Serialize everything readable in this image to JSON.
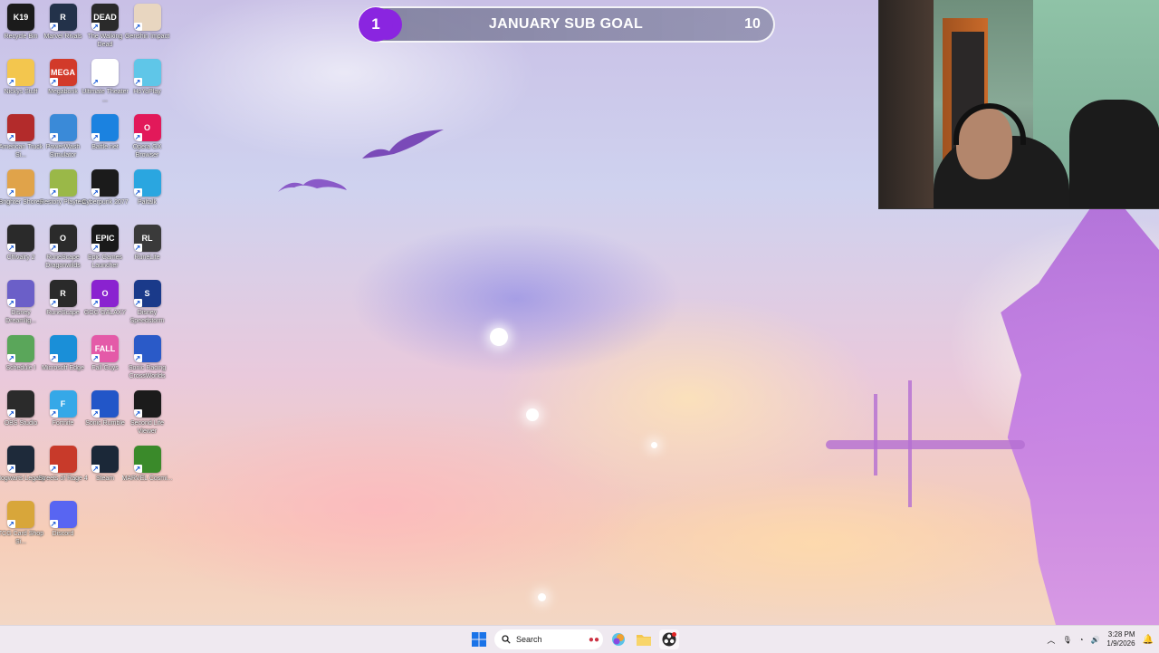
{
  "subgoal": {
    "current": "1",
    "title": "JANUARY SUB GOAL",
    "target": "10"
  },
  "desktop_icons": [
    {
      "label": "Recycle Bin",
      "icon": "recycle-bin-icon",
      "color": "#1b1b1b",
      "badge": "K19"
    },
    {
      "label": "Marvel Rivals",
      "icon": "marvel-rivals-icon",
      "color": "#23324a",
      "badge": "R"
    },
    {
      "label": "The Walking Dead",
      "icon": "walking-dead-icon",
      "color": "#2a2a2a",
      "badge": "DEAD"
    },
    {
      "label": "Genshin Impact",
      "icon": "genshin-icon",
      "color": "#e8d6c0",
      "badge": ""
    },
    {
      "label": "Nickys Stuff",
      "icon": "folder-icon",
      "color": "#f3c64e",
      "badge": ""
    },
    {
      "label": "Megabonk",
      "icon": "megabonk-icon",
      "color": "#d23a2a",
      "badge": "MEGA"
    },
    {
      "label": "Ultimate Theater ...",
      "icon": "popcorn-icon",
      "color": "#ffffff",
      "badge": ""
    },
    {
      "label": "HoYoPlay",
      "icon": "hoyoplay-icon",
      "color": "#5fc6e8",
      "badge": ""
    },
    {
      "label": "American Truck Si...",
      "icon": "truck-icon",
      "color": "#b32b2b",
      "badge": ""
    },
    {
      "label": "PowerWash Simulator",
      "icon": "powerwash-icon",
      "color": "#3a8ad8",
      "badge": ""
    },
    {
      "label": "Battle.net",
      "icon": "battlenet-icon",
      "color": "#1b82e0",
      "badge": ""
    },
    {
      "label": "Opera GX Browser",
      "icon": "opera-gx-icon",
      "color": "#e2195a",
      "badge": "O"
    },
    {
      "label": "Brighter Shores",
      "icon": "brighter-shores-icon",
      "color": "#e0a34a",
      "badge": ""
    },
    {
      "label": "Restory Playtest",
      "icon": "restory-icon",
      "color": "#9ab848",
      "badge": ""
    },
    {
      "label": "Cyberpunk 2077",
      "icon": "cyberpunk-icon",
      "color": "#1b1b1b",
      "badge": ""
    },
    {
      "label": "Paltalk",
      "icon": "paltalk-icon",
      "color": "#2aa6e0",
      "badge": ""
    },
    {
      "label": "Chivalry 2",
      "icon": "chivalry-icon",
      "color": "#2a2a2a",
      "badge": ""
    },
    {
      "label": "RuneScape Dragonwilds",
      "icon": "dragonwilds-icon",
      "color": "#2b2b2b",
      "badge": "O"
    },
    {
      "label": "Epic Games Launcher",
      "icon": "epic-games-icon",
      "color": "#1a1a1a",
      "badge": "EPIC"
    },
    {
      "label": "RuneLite",
      "icon": "runelite-icon",
      "color": "#3a3a3a",
      "badge": "RL"
    },
    {
      "label": "Disney Dreamlig...",
      "icon": "disney-dreamlight-icon",
      "color": "#6b5fc8",
      "badge": ""
    },
    {
      "label": "RuneScape",
      "icon": "runescape-icon",
      "color": "#2a2a2a",
      "badge": "R"
    },
    {
      "label": "GOG GALAXY",
      "icon": "gog-galaxy-icon",
      "color": "#8a22d0",
      "badge": "O"
    },
    {
      "label": "Disney Speedstorm",
      "icon": "speedstorm-icon",
      "color": "#1a3a8a",
      "badge": "S"
    },
    {
      "label": "Schedule I",
      "icon": "schedule-icon",
      "color": "#5aa65a",
      "badge": ""
    },
    {
      "label": "Microsoft Edge",
      "icon": "edge-icon",
      "color": "#1a8fd8",
      "badge": ""
    },
    {
      "label": "Fall Guys",
      "icon": "fall-guys-icon",
      "color": "#e45aa8",
      "badge": "FALL"
    },
    {
      "label": "Sonic Racing CrossWorlds",
      "icon": "sonic-racing-icon",
      "color": "#2a5ac8",
      "badge": ""
    },
    {
      "label": "OBS Studio",
      "icon": "obs-icon",
      "color": "#2b2b2b",
      "badge": ""
    },
    {
      "label": "Fortnite",
      "icon": "fortnite-icon",
      "color": "#35a8e8",
      "badge": "F"
    },
    {
      "label": "Sonic Rumble",
      "icon": "sonic-rumble-icon",
      "color": "#2256c8",
      "badge": ""
    },
    {
      "label": "Second Life Viewer",
      "icon": "second-life-icon",
      "color": "#1b1b1b",
      "badge": ""
    },
    {
      "label": "Hogwarts Legacy",
      "icon": "hogwarts-icon",
      "color": "#1e2a3a",
      "badge": ""
    },
    {
      "label": "Streets of Rage 4",
      "icon": "streets-of-rage-icon",
      "color": "#c83a2a",
      "badge": ""
    },
    {
      "label": "Steam",
      "icon": "steam-icon",
      "color": "#1b2838",
      "badge": ""
    },
    {
      "label": "MARVEL Cosmi...",
      "icon": "marvel-cosmic-icon",
      "color": "#3a8a2a",
      "badge": ""
    },
    {
      "label": "TCG Card Shop Si...",
      "icon": "tcg-card-shop-icon",
      "color": "#d8a63a",
      "badge": ""
    },
    {
      "label": "Discord",
      "icon": "discord-icon",
      "color": "#5865f2",
      "badge": ""
    }
  ],
  "taskbar": {
    "search_placeholder": "Search",
    "clock_time": "3:28 PM",
    "clock_date": "1/9/2026"
  }
}
